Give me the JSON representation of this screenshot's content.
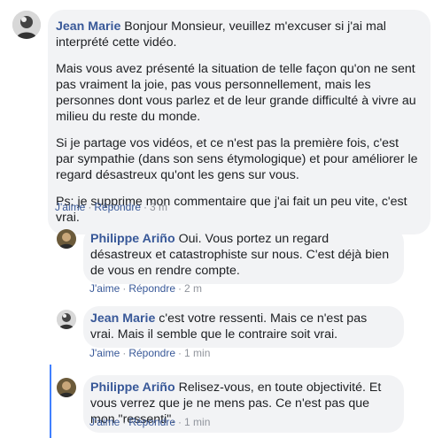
{
  "comments": [
    {
      "author": "Jean Marie",
      "paragraphs": [
        "Bonjour Monsieur, veuillez m'excuser si j'ai mal interprété cette vidéo.",
        "Mais vous avez présenté la situation de telle façon qu'on ne sent pas vraiment la joie, pas vous personnellement, mais les personnes dont vous parlez et de leur grande difficulté à vivre au milieu du reste du monde.",
        "Si je partage vos vidéos, et ce n'est pas la première fois, c'est par sympathie (dans son sens étymologique) et pour améliorer le regard désastreux qu'ont les gens sur vous.",
        "Ps: je supprime mon commentaire que j'ai fait un peu vite, c'est vrai."
      ],
      "like_label": "J'aime",
      "reply_label": "Répondre",
      "time": "3 m"
    },
    {
      "author": "Philippe Ariño",
      "text": "Oui. Vous portez un regard désastreux et catastrophiste sur nous. C'est déjà bien de vous en rendre compte.",
      "like_label": "J'aime",
      "reply_label": "Répondre",
      "time": "2 m"
    },
    {
      "author": "Jean Marie",
      "text": "c'est votre ressenti. Mais ce n'est pas vrai. Mais il semble que le contraire soit vrai.",
      "like_label": "J'aime",
      "reply_label": "Répondre",
      "time": "1 min"
    },
    {
      "author": "Philippe Ariño",
      "text": "Relisez-vous, en toute objectivité. Et vous verrez que je ne mens pas. Ce n'est pas que mon \"ressenti\".",
      "like_label": "J'aime",
      "reply_label": "Répondre",
      "time": "1 min"
    }
  ]
}
